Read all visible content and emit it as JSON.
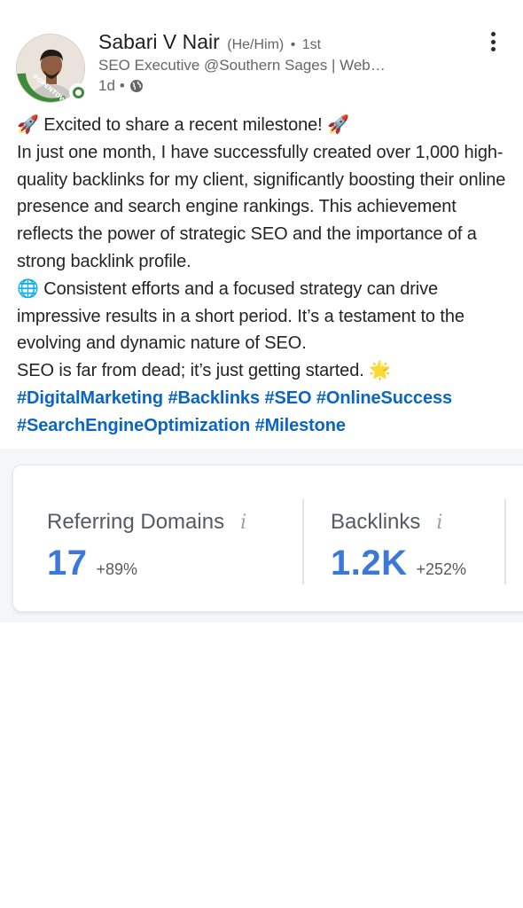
{
  "author": {
    "name": "Sabari V Nair",
    "pronouns": "(He/Him)",
    "separator": "•",
    "degree": "1st",
    "headline": "SEO Executive @Southern Sages | Web…",
    "time": "1d",
    "visibility_icon": "globe-icon",
    "avatar_frame_text": "#OPENTOWORK",
    "frame_color": "#3f8a3a"
  },
  "menu_icon": "more-vertical-icon",
  "post": {
    "line1": "🚀 Excited to share a recent milestone! 🚀",
    "paragraph1": "In just one month, I have successfully created over 1,000 high-quality backlinks for my client, significantly boosting their online presence and search engine rankings. This achievement reflects the power of strategic SEO and the importance of a strong backlink profile.",
    "paragraph2": "🌐 Consistent efforts and a focused strategy can drive impressive results in a short period. It’s a testament to the evolving and dynamic nature of SEO.",
    "paragraph3": "SEO is far from dead; it’s just getting started. 🌟",
    "hashtags": [
      "#DigitalMarketing",
      "#Backlinks",
      "#SEO",
      "#OnlineSuccess",
      "#SearchEngineOptimization",
      "#Milestone"
    ]
  },
  "metrics": [
    {
      "label": "Referring Domains",
      "info": "i",
      "value": "17",
      "change": "+89%"
    },
    {
      "label": "Backlinks",
      "info": "i",
      "value": "1.2K",
      "change": "+252%"
    }
  ],
  "colors": {
    "link": "#0a66c2",
    "metric_value": "#3b78d8"
  }
}
